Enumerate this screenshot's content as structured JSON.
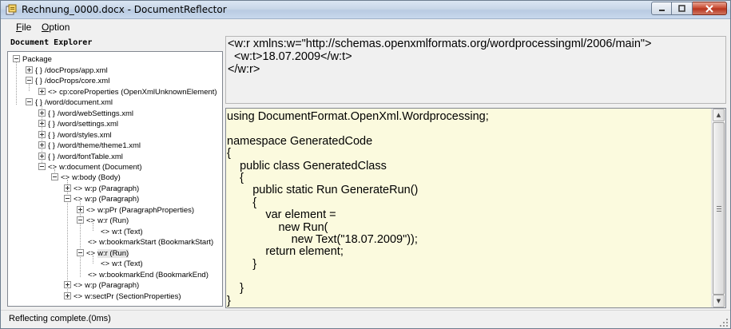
{
  "window": {
    "title": "Rechnung_0000.docx - DocumentReflector"
  },
  "menu": {
    "items": [
      {
        "label": "File",
        "accel": "F",
        "rest": "ile"
      },
      {
        "label": "Option",
        "accel": "O",
        "rest": "ption"
      }
    ]
  },
  "explorer": {
    "header": "Document Explorer",
    "nodes": [
      {
        "label": "Package",
        "icon": "",
        "expander": "minus"
      },
      {
        "label": "/docProps/app.xml",
        "icon": "{ }",
        "expander": "plus"
      },
      {
        "label": "/docProps/core.xml",
        "icon": "{ }",
        "expander": "minus"
      },
      {
        "label": "cp:coreProperties (OpenXmlUnknownElement)",
        "icon": "<>",
        "expander": "plus"
      },
      {
        "label": "/word/document.xml",
        "icon": "{ }",
        "expander": "minus"
      },
      {
        "label": "/word/webSettings.xml",
        "icon": "{ }",
        "expander": "plus"
      },
      {
        "label": "/word/settings.xml",
        "icon": "{ }",
        "expander": "plus"
      },
      {
        "label": "/word/styles.xml",
        "icon": "{ }",
        "expander": "plus"
      },
      {
        "label": "/word/theme/theme1.xml",
        "icon": "{ }",
        "expander": "plus"
      },
      {
        "label": "/word/fontTable.xml",
        "icon": "{ }",
        "expander": "plus"
      },
      {
        "label": "w:document (Document)",
        "icon": "<>",
        "expander": "minus"
      },
      {
        "label": "w:body (Body)",
        "icon": "<>",
        "expander": "minus"
      },
      {
        "label": "w:p (Paragraph)",
        "icon": "<>",
        "expander": "plus"
      },
      {
        "label": "w:p (Paragraph)",
        "icon": "<>",
        "expander": "minus"
      },
      {
        "label": "w:pPr (ParagraphProperties)",
        "icon": "<>",
        "expander": "plus"
      },
      {
        "label": "w:r (Run)",
        "icon": "<>",
        "expander": "minus"
      },
      {
        "label": "w:t (Text)",
        "icon": "<>",
        "expander": ""
      },
      {
        "label": "w:bookmarkStart (BookmarkStart)",
        "icon": "<>",
        "expander": ""
      },
      {
        "label": "w:r (Run)",
        "icon": "<>",
        "expander": "minus"
      },
      {
        "label": "w:t (Text)",
        "icon": "<>",
        "expander": ""
      },
      {
        "label": "w:bookmarkEnd (BookmarkEnd)",
        "icon": "<>",
        "expander": ""
      },
      {
        "label": "w:p (Paragraph)",
        "icon": "<>",
        "expander": "plus"
      },
      {
        "label": "w:sectPr (SectionProperties)",
        "icon": "<>",
        "expander": "plus"
      }
    ]
  },
  "xml_view": {
    "lines": [
      "<w:r xmlns:w=\"http://schemas.openxmlformats.org/wordprocessingml/2006/main\">",
      "  <w:t>18.07.2009</w:t>",
      "</w:r>"
    ]
  },
  "code_view": {
    "lines": [
      "using DocumentFormat.OpenXml.Wordprocessing;",
      "",
      "namespace GeneratedCode",
      "{",
      "    public class GeneratedClass",
      "    {",
      "        public static Run GenerateRun()",
      "        {",
      "            var element =",
      "                new Run(",
      "                    new Text(\"18.07.2009\"));",
      "            return element;",
      "        }",
      "",
      "    }",
      "}"
    ]
  },
  "status": {
    "text": "Reflecting complete.(0ms)"
  }
}
